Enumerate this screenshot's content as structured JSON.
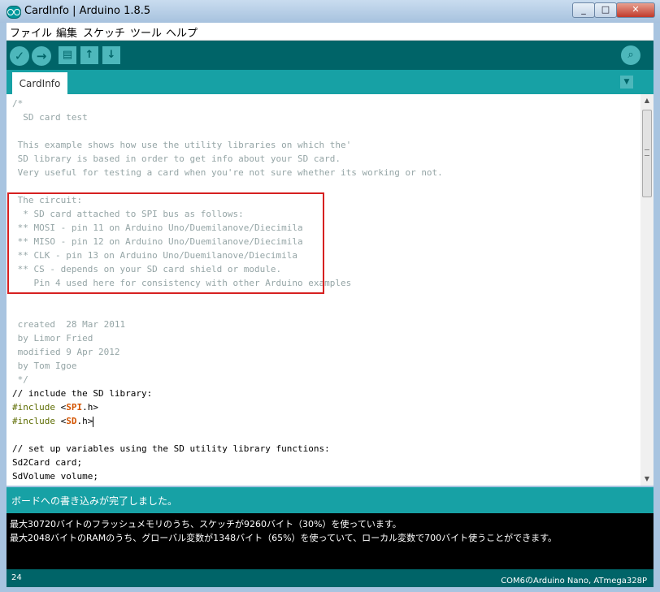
{
  "window": {
    "title": "CardInfo | Arduino 1.8.5",
    "minimize": "_",
    "maximize": "□",
    "close": "✕"
  },
  "menu": [
    "ファイル",
    "編集",
    "スケッチ",
    "ツール",
    "ヘルプ"
  ],
  "toolbar": {
    "verify": "✓",
    "upload": "→",
    "new": "▤",
    "open": "↑",
    "save": "↓",
    "serial": "⌕"
  },
  "tabs": [
    {
      "label": "CardInfo"
    }
  ],
  "tab_menu": "▼",
  "code": {
    "l1": "/*",
    "l2": "  SD card test",
    "l4": " This example shows how use the utility libraries on which the'",
    "l5": " SD library is based in order to get info about your SD card.",
    "l6": " Very useful for testing a card when you're not sure whether its working or not.",
    "l8": " The circuit:",
    "l9": "  * SD card attached to SPI bus as follows:",
    "l10": " ** MOSI - pin 11 on Arduino Uno/Duemilanove/Diecimila",
    "l11": " ** MISO - pin 12 on Arduino Uno/Duemilanove/Diecimila",
    "l12": " ** CLK - pin 13 on Arduino Uno/Duemilanove/Diecimila",
    "l13": " ** CS - depends on your SD card shield or module.",
    "l14": "    Pin 4 used here for consistency with other Arduino examples",
    "l17": " created  28 Mar 2011",
    "l18": " by Limor Fried",
    "l19": " modified 9 Apr 2012",
    "l20": " by Tom Igoe",
    "l21": " */",
    "l22": "// include the SD library:",
    "include": "#include",
    "lt": " <",
    "spi": "SPI",
    "sd": "SD",
    "h_close": ".h>",
    "l26": "// set up variables using the SD utility library functions:",
    "l27": "Sd2Card card;",
    "l28": "SdVolume volume;"
  },
  "status": "ボードへの書き込みが完了しました。",
  "console": [
    "最大30720バイトのフラッシュメモリのうち、スケッチが9260バイト（30%）を使っています。",
    "最大2048バイトのRAMのうち、グローバル変数が1348バイト（65%）を使っていて、ローカル変数で700バイト使うことができます。"
  ],
  "footer": {
    "line": "24",
    "board": "COM6のArduino Nano, ATmega328P"
  }
}
